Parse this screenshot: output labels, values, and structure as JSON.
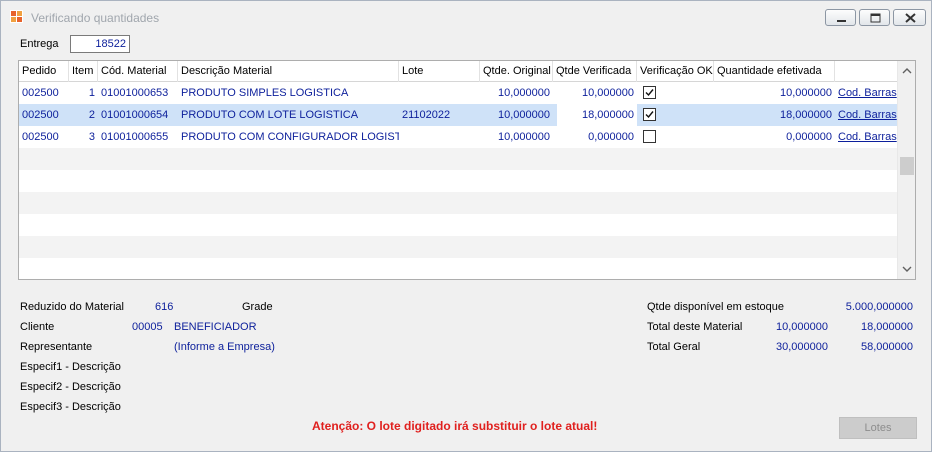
{
  "window": {
    "title": "Verificando quantidades"
  },
  "entrega": {
    "label": "Entrega",
    "value": "18522"
  },
  "grid": {
    "columns": [
      "Pedido",
      "Item",
      "Cód. Material",
      "Descrição Material",
      "Lote",
      "Qtde. Original",
      "Qtde Verificada",
      "Verificação OK",
      "Quantidade efetivada",
      ""
    ],
    "rows": [
      {
        "pedido": "002500",
        "item": "1",
        "cod": "01001000653",
        "descricao": "PRODUTO SIMPLES LOGISTICA",
        "lote": "",
        "original": "10,000000",
        "verificada": "10,000000",
        "ok": true,
        "efetivada": "10,000000",
        "link": "Cod. Barras"
      },
      {
        "pedido": "002500",
        "item": "2",
        "cod": "01001000654",
        "descricao": "PRODUTO COM LOTE LOGISTICA",
        "lote": "21102022",
        "original": "10,000000",
        "verificada": "18,000000",
        "ok": true,
        "efetivada": "18,000000",
        "link": "Cod. Barras"
      },
      {
        "pedido": "002500",
        "item": "3",
        "cod": "01001000655",
        "descricao": "PRODUTO COM CONFIGURADOR LOGISTICA",
        "lote": "",
        "original": "10,000000",
        "verificada": "0,000000",
        "ok": false,
        "efetivada": "0,000000",
        "link": "Cod. Barras"
      }
    ]
  },
  "details": {
    "reduzido_label": "Reduzido do Material",
    "reduzido_value": "616",
    "grade_label": "Grade",
    "cliente_label": "Cliente",
    "cliente_code": "00005",
    "cliente_name": "BENEFICIADOR",
    "representante_label": "Representante",
    "representante_value": "(Informe a Empresa)",
    "especif1_label": "Especif1 - Descrição",
    "especif2_label": "Especif2 - Descrição",
    "especif3_label": "Especif3 - Descrição"
  },
  "totals": {
    "estoque_label": "Qtde disponível em estoque",
    "estoque_value": "5.000,000000",
    "material_label": "Total deste Material",
    "material_value1": "10,000000",
    "material_value2": "18,000000",
    "geral_label": "Total Geral",
    "geral_value1": "30,000000",
    "geral_value2": "58,000000"
  },
  "warning": "Atenção: O lote digitado irá substituir o lote atual!",
  "buttons": {
    "lotes": "Lotes"
  },
  "icons": {
    "app": "app-logo-icon",
    "minimize": "minimize-icon",
    "maximize": "maximize-icon",
    "close": "close-icon",
    "checkbox": "checkmark-icon",
    "scroll_up": "chevron-up-icon",
    "scroll_down": "chevron-down-icon"
  },
  "colors": {
    "value_text": "#0c1f9b",
    "warning": "#e0201e",
    "selected_row": "#cfe2f8"
  }
}
